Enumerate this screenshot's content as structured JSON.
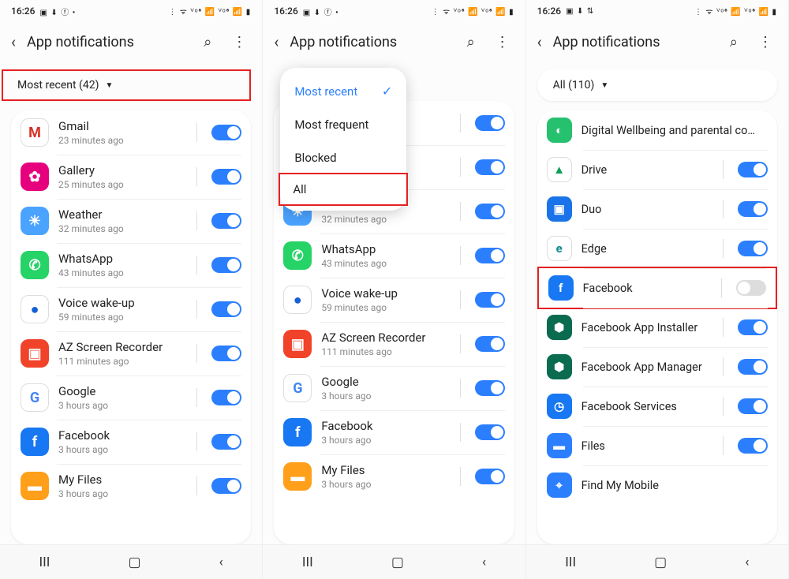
{
  "status": {
    "time": "16:26",
    "left_icons": "▣ ⬇ ⓕ •",
    "right_icons": "⋮ ᯤ ⱽᵒ⁶ 📶 ⱽᵒ⁶ 📶 ▮"
  },
  "header": {
    "title": "App notifications"
  },
  "panel1": {
    "filter_label": "Most recent (42)",
    "apps": [
      {
        "name": "Gmail",
        "sub": "23 minutes ago",
        "on": true,
        "icon": "M",
        "bg": "#fff",
        "fg": "#d93025",
        "border": "1px solid #ddd"
      },
      {
        "name": "Gallery",
        "sub": "25 minutes ago",
        "on": true,
        "icon": "✿",
        "bg": "#e6007e"
      },
      {
        "name": "Weather",
        "sub": "32 minutes ago",
        "on": true,
        "icon": "☀",
        "bg": "#4aa3ff"
      },
      {
        "name": "WhatsApp",
        "sub": "43 minutes ago",
        "on": true,
        "icon": "✆",
        "bg": "#25d366"
      },
      {
        "name": "Voice wake-up",
        "sub": "59 minutes ago",
        "on": true,
        "icon": "●",
        "bg": "#fff",
        "fg": "#1560d4",
        "border": "1px solid #ddd"
      },
      {
        "name": "AZ Screen Recorder",
        "sub": "111 minutes ago",
        "on": true,
        "icon": "▣",
        "bg": "#f0432a"
      },
      {
        "name": "Google",
        "sub": "3 hours ago",
        "on": true,
        "icon": "G",
        "bg": "#fff",
        "fg": "#4285f4",
        "border": "1px solid #ddd"
      },
      {
        "name": "Facebook",
        "sub": "3 hours ago",
        "on": true,
        "icon": "f",
        "bg": "#1877f2"
      },
      {
        "name": "My Files",
        "sub": "3 hours ago",
        "on": true,
        "icon": "▬",
        "bg": "#ff9f1a"
      }
    ]
  },
  "panel2": {
    "dropdown": [
      {
        "label": "Most recent",
        "selected": true
      },
      {
        "label": "Most frequent",
        "selected": false
      },
      {
        "label": "Blocked",
        "selected": false
      },
      {
        "label": "All",
        "selected": false,
        "highlight": true
      }
    ],
    "apps": [
      {
        "name": "",
        "sub": "",
        "on": true,
        "icon": " ",
        "bg": "#fff"
      },
      {
        "name": "",
        "sub": "",
        "on": true,
        "icon": " ",
        "bg": "#fff"
      },
      {
        "name": "Weather",
        "sub": "32 minutes ago",
        "on": true,
        "icon": "☀",
        "bg": "#4aa3ff"
      },
      {
        "name": "WhatsApp",
        "sub": "43 minutes ago",
        "on": true,
        "icon": "✆",
        "bg": "#25d366"
      },
      {
        "name": "Voice wake-up",
        "sub": "59 minutes ago",
        "on": true,
        "icon": "●",
        "bg": "#fff",
        "fg": "#1560d4",
        "border": "1px solid #ddd"
      },
      {
        "name": "AZ Screen Recorder",
        "sub": "111 minutes ago",
        "on": true,
        "icon": "▣",
        "bg": "#f0432a"
      },
      {
        "name": "Google",
        "sub": "3 hours ago",
        "on": true,
        "icon": "G",
        "bg": "#fff",
        "fg": "#4285f4",
        "border": "1px solid #ddd"
      },
      {
        "name": "Facebook",
        "sub": "3 hours ago",
        "on": true,
        "icon": "f",
        "bg": "#1877f2"
      },
      {
        "name": "My Files",
        "sub": "3 hours ago",
        "on": true,
        "icon": "▬",
        "bg": "#ff9f1a"
      }
    ]
  },
  "panel3": {
    "filter_label": "All (110)",
    "apps": [
      {
        "name": "Digital Wellbeing and parental co…",
        "sub": "",
        "on": null,
        "icon": "◐",
        "bg": "#25c16f"
      },
      {
        "name": "Drive",
        "sub": "",
        "on": true,
        "icon": "▲",
        "bg": "#fff",
        "fg": "#0f9d58",
        "border": "1px solid #ddd"
      },
      {
        "name": "Duo",
        "sub": "",
        "on": true,
        "icon": "▣",
        "bg": "#1a73e8"
      },
      {
        "name": "Edge",
        "sub": "",
        "on": true,
        "icon": "e",
        "bg": "#fff",
        "fg": "#0c8a8f",
        "border": "1px solid #ddd"
      },
      {
        "name": "Facebook",
        "sub": "",
        "on": false,
        "icon": "f",
        "bg": "#1877f2",
        "highlight": true
      },
      {
        "name": "Facebook App Installer",
        "sub": "",
        "on": true,
        "icon": "⬢",
        "bg": "#0a6b4f"
      },
      {
        "name": "Facebook App Manager",
        "sub": "",
        "on": true,
        "icon": "⬢",
        "bg": "#0a6b4f"
      },
      {
        "name": "Facebook Services",
        "sub": "",
        "on": true,
        "icon": "◷",
        "bg": "#1877f2"
      },
      {
        "name": "Files",
        "sub": "",
        "on": true,
        "icon": "▬",
        "bg": "#2b7fff"
      },
      {
        "name": "Find My Mobile",
        "sub": "",
        "on": null,
        "icon": "⌖",
        "bg": "#2b7fff"
      }
    ]
  }
}
